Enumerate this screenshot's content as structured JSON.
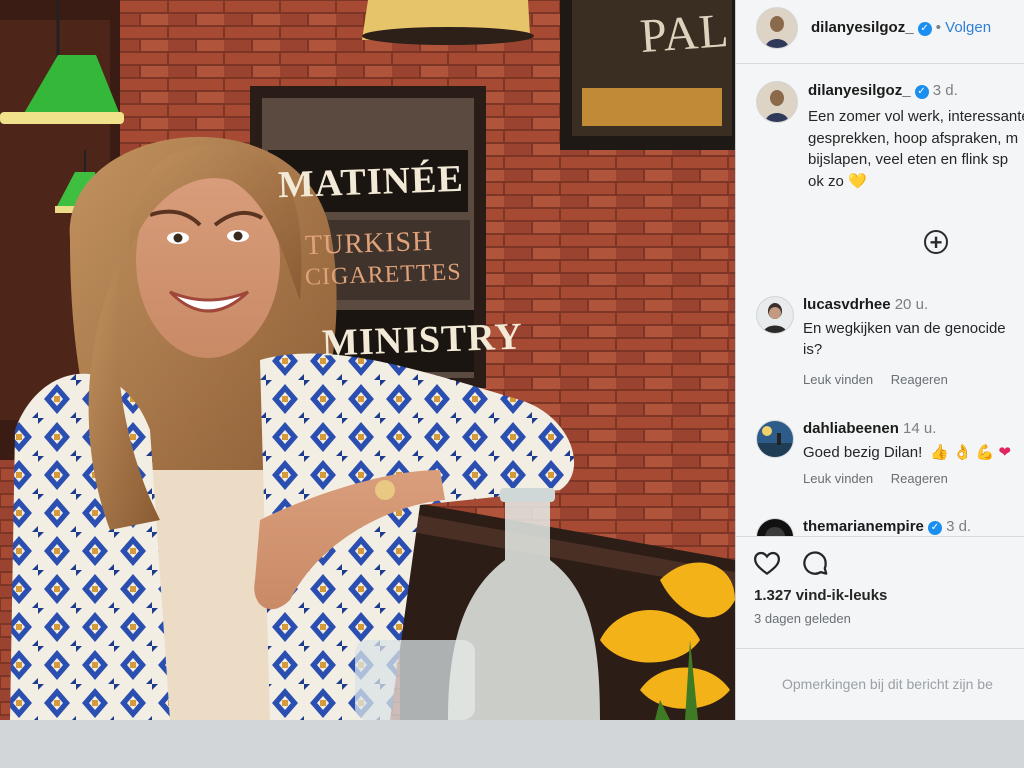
{
  "photo": {
    "signs": {
      "matinee": "MATINÉE",
      "turkish": "TURKISH",
      "cigarettes": "CIGARETTES",
      "ministry": "MINISTRY",
      "pal": "PAL"
    }
  },
  "header": {
    "username": "dilanyesilgoz_",
    "separator": "•",
    "follow_label": "Volgen"
  },
  "post": {
    "username": "dilanyesilgoz_",
    "age": "3 d.",
    "caption": "Een zomer vol werk, interessante\ngesprekken, hoop afspraken, m\nbijslapen, veel eten en flink sp\nok zo",
    "caption_emoji": "💛"
  },
  "load_more_icon": "plus-circle-icon",
  "comments": [
    {
      "username": "lucasvdrhee",
      "age": "20 u.",
      "text": "En wegkijken van de genocide\nis?",
      "like_label": "Leuk vinden",
      "reply_label": "Reageren"
    },
    {
      "username": "dahliabeenen",
      "age": "14 u.",
      "text": "Goed bezig Dilan!",
      "emojis": [
        "👍",
        "👌",
        "💪",
        "❤"
      ],
      "like_label": "Leuk vinden",
      "reply_label": "Reageren"
    },
    {
      "username": "themarianempire",
      "age": "3 d."
    }
  ],
  "actions": {
    "like_icon": "heart-icon",
    "comment_icon": "comment-icon",
    "likes_text": "1.327 vind-ik-leuks",
    "date_text": "3 dagen geleden",
    "comments_disabled_text": "Opmerkingen bij dit bericht zijn be"
  },
  "colors": {
    "verified": "#1b8ff0",
    "follow": "#2f7fd8",
    "panel_bg": "#f3f5f6"
  }
}
